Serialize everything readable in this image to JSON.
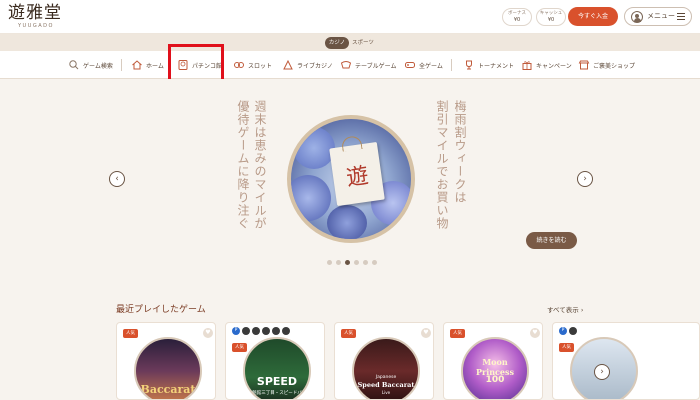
{
  "header": {
    "logo_text": "遊雅堂",
    "logo_sub": "YUUGADO",
    "bonus_label": "ボーナス",
    "bonus_value": "¥0",
    "cash_label": "キャッシュ",
    "cash_value": "¥0",
    "deposit_label": "今すぐ入金",
    "menu_label": "メニュー"
  },
  "categories": {
    "casino": "カジノ",
    "sports": "スポーツ"
  },
  "nav": {
    "search": "ゲーム検索",
    "home": "ホーム",
    "pachinko": "パチンコ館",
    "slots": "スロット",
    "live_casino": "ライブカジノ",
    "table_games": "テーブルゲーム",
    "all_games": "全ゲーム",
    "tournament": "トーナメント",
    "campaign": "キャンペーン",
    "shop": "ご褒美ショップ"
  },
  "hero": {
    "left_line1": "週末は恵みのマイルが",
    "left_line2": "優待ゲームに降り注ぐ",
    "right_line1": "梅雨割ウィークは",
    "right_line2": "割引マイルでお買い物",
    "bag_char": "遊",
    "read_more": "続きを読む",
    "prev_arrow": "‹",
    "next_arrow": "›",
    "slide_count": 6,
    "active_slide": 3
  },
  "recent": {
    "title": "最近プレイしたゲーム",
    "show_all": "すべて表示 ›",
    "next_arrow": "›",
    "badge_popular": "人気",
    "games": [
      {
        "title": "Baccarat"
      },
      {
        "title": "SPEED",
        "subtitle": "花魁館三丁目・スピードバカ"
      },
      {
        "title": "Speed Baccarat",
        "prefix": "Japanese",
        "suffix": "Live"
      },
      {
        "title": "Moon Princess",
        "number": "100"
      },
      {
        "title": ""
      }
    ]
  },
  "colors": {
    "accent": "#d9512c",
    "brown": "#6a5444",
    "highlight": "#e0101b",
    "page_bg": "#f7f3ee"
  }
}
